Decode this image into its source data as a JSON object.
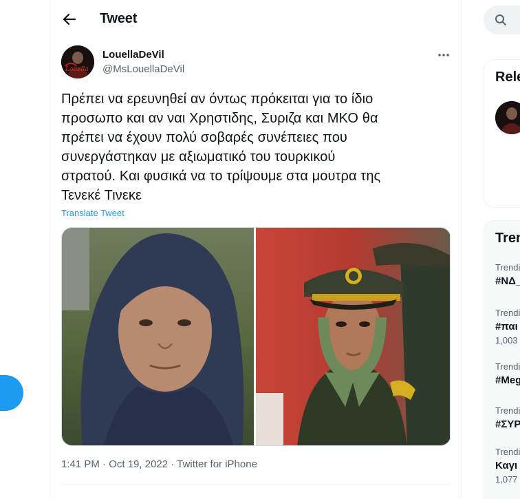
{
  "header": {
    "title": "Tweet",
    "back_icon": "arrow-left-icon"
  },
  "tweet": {
    "author": {
      "display_name": "LouellaDeVil",
      "handle": "@MsLouellaDeVil",
      "avatar_text": "Louella"
    },
    "text_lines": [
      "Πρέπει να ερευνηθεί αν όντως πρόκειται για το ίδιο",
      "προσωπο και αν ναι Χρηστιδης, Συριζα και ΜΚΟ θα",
      "πρέπει να έχουν πολύ σοβαρές συνέπειες που",
      "συνεργάστηκαν με αξιωματικό του τουρκικού",
      "στρατού. Και φυσικά να το τρίψουμε στα μουτρα της",
      "Τενεκέ Τινεκε"
    ],
    "translate_label": "Translate Tweet",
    "time": "1:41 PM",
    "date": "Oct 19, 2022",
    "source": "Twitter for iPhone",
    "separator": "·"
  },
  "sidebar": {
    "relevant_title": "Rele",
    "trends_title": "Tren",
    "trends": [
      {
        "category": "Trendi",
        "name": "#ΝΔ_",
        "count": ""
      },
      {
        "category": "Trendi",
        "name": "#παι",
        "count": "1,003"
      },
      {
        "category": "Trendi",
        "name": "#Meg",
        "count": ""
      },
      {
        "category": "Trendi",
        "name": "#ΣΥΡ",
        "count": ""
      },
      {
        "category": "Trendi",
        "name": "Καγι",
        "count": "1,077"
      }
    ]
  },
  "colors": {
    "accent": "#1d9bf0",
    "text_primary": "#0f1419",
    "text_secondary": "#536471",
    "border": "#eff3f4"
  }
}
